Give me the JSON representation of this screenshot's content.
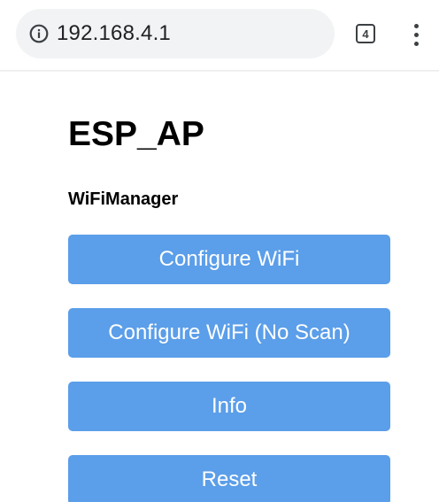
{
  "browser": {
    "url": "192.168.4.1",
    "tab_count": "4",
    "icons": {
      "info": "info-icon",
      "menu": "more-vertical-icon"
    }
  },
  "page": {
    "title": "ESP_AP",
    "subtitle": "WiFiManager",
    "buttons": {
      "configure_wifi": "Configure WiFi",
      "configure_wifi_no_scan": "Configure WiFi (No Scan)",
      "info": "Info",
      "reset": "Reset"
    }
  },
  "colors": {
    "button_bg": "#5b9ee9",
    "button_text": "#ffffff",
    "address_bar_bg": "#f1f3f4"
  }
}
